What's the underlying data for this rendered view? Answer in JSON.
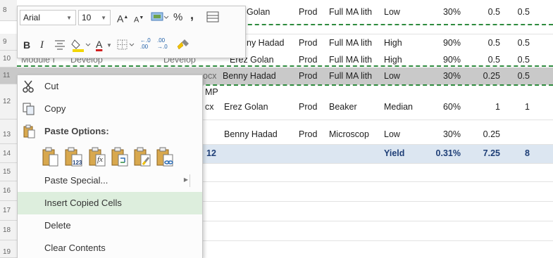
{
  "sheet": {
    "row_numbers": [
      "8",
      "9",
      "10",
      "11",
      "12",
      "13",
      "14",
      "15",
      "16",
      "17",
      "18",
      "19"
    ],
    "rows": [
      {
        "row": "8",
        "c1": "",
        "c2": "",
        "c3": "",
        "c4": "Golan",
        "c5": "Prod",
        "c6": "Full MA lith",
        "c7": "Low",
        "c8": "30%",
        "c9": "0.5",
        "c10": "0.5"
      },
      {
        "row": "9",
        "c1": "",
        "c2": "",
        "c3": "",
        "c4": "ny Hadad",
        "c5": "Prod",
        "c6": "Full MA lith",
        "c7": "High",
        "c8": "90%",
        "c9": "0.5",
        "c10": "0.5"
      },
      {
        "row": "10",
        "c1": "Module I",
        "c2": "Develop",
        "c3": "Develop",
        "c4": "Erez Golan",
        "c5": "Prod",
        "c6": "Full MA lith",
        "c7": "High",
        "c8": "90%",
        "c9": "0.5",
        "c10": "0.5"
      },
      {
        "row": "11",
        "c1": "",
        "c2": "",
        "c3": "ocx",
        "c4": "Benny Hadad",
        "c5": "Prod",
        "c6": "Full MA lith",
        "c7": "Low",
        "c8": "30%",
        "c9": "0.25",
        "c10": "0.5"
      },
      {
        "row": "12",
        "c1": "",
        "c2": "",
        "c3": "MP",
        "c3b": "cx",
        "c4": "Erez Golan",
        "c5": "Prod",
        "c6": "Beaker",
        "c7": "Median",
        "c8": "60%",
        "c9": "1",
        "c10": "1"
      },
      {
        "row": "13",
        "c1": "",
        "c2": "",
        "c3": "",
        "c4": "Benny Hadad",
        "c5": "Prod",
        "c6": "Microscop",
        "c7": "Low",
        "c8": "30%",
        "c9": "0.25",
        "c10": ""
      },
      {
        "row": "14",
        "c1": "",
        "c2": "",
        "c3": "12",
        "c4": "",
        "c5": "",
        "c6": "",
        "c7": "Yield",
        "c8": "0.31%",
        "c9": "7.25",
        "c10": "8"
      }
    ]
  },
  "mini_toolbar": {
    "font_name": "Arial",
    "font_size": "10",
    "grow_font": "A",
    "shrink_font": "A",
    "percent": "%",
    "comma": ",",
    "bold": "B",
    "italic": "I",
    "font_color_letter": "A",
    "increase_decimal": "←.0\n.00",
    "decrease_decimal": ".00\n→.0"
  },
  "context_menu": {
    "cut": "Cut",
    "copy": "Copy",
    "paste_options": "Paste Options:",
    "paste_special": "Paste Special...",
    "insert_copied_cells": "Insert Copied Cells",
    "delete": "Delete",
    "clear_contents": "Clear Contents",
    "paste_icons": [
      "paste",
      "values",
      "formulas",
      "transpose",
      "formatting",
      "paste-link"
    ],
    "paste_values_label": "123",
    "paste_formulas_label": "fx"
  },
  "colors": {
    "selection_row": "#c9c9c9",
    "header_row": "#dce6f1",
    "dash_border": "#2e8b3e",
    "highlight": "#ddeedd",
    "yellow_fill": "#f2d600",
    "red_font": "#d22020"
  }
}
